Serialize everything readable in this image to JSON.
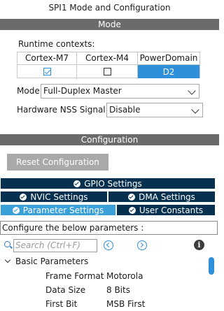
{
  "window": {
    "title": "SPI1 Mode and Configuration"
  },
  "mode_section": {
    "header": "Mode"
  },
  "runtime_contexts": {
    "label": "Runtime contexts:",
    "columns": [
      {
        "name": "Cortex-M7",
        "state": "checked"
      },
      {
        "name": "Cortex-M4",
        "state": "unchecked"
      },
      {
        "name": "PowerDomain",
        "value": "D2"
      }
    ]
  },
  "mode": {
    "label": "Mode",
    "value": "Full-Duplex Master"
  },
  "nss": {
    "label": "Hardware NSS Signal",
    "value": "Disable"
  },
  "configuration_section": {
    "header": "Configuration",
    "reset_label": "Reset Configuration"
  },
  "tabs": {
    "gpio": "GPIO Settings",
    "nvic": "NVIC Settings",
    "dma": "DMA Settings",
    "parameter": "Parameter Settings",
    "user_constants": "User Constants",
    "active": "parameter"
  },
  "config_hint": "Configure the below parameters :",
  "search": {
    "placeholder": "Search (Ctrl+F)"
  },
  "parameters": {
    "group_label": "Basic Parameters",
    "items": [
      {
        "name": "Frame Format",
        "value": "Motorola"
      },
      {
        "name": "Data Size",
        "value": "8 Bits"
      },
      {
        "name": "First Bit",
        "value": "MSB First"
      }
    ]
  },
  "colors": {
    "header_bar": "#6b6b6b",
    "tab_dark": "#06304f",
    "tab_active": "#3aa0d8",
    "accent": "#2e8fda"
  }
}
